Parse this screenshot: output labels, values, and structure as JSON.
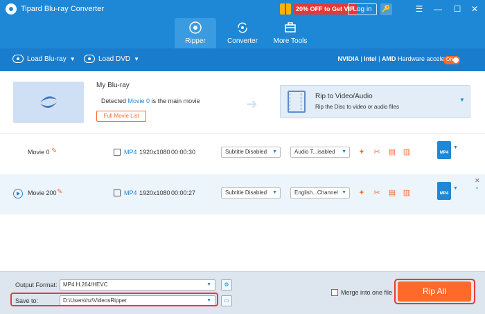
{
  "window": {
    "title": "Tipard Blu-ray Converter",
    "promo_text": "20% OFF to Get VIP",
    "login_label": "Log in",
    "controls": [
      "☰",
      "—",
      "☐",
      "✕"
    ]
  },
  "nav": {
    "tabs": [
      {
        "label": "Ripper",
        "icon": "ripper-icon",
        "active": true
      },
      {
        "label": "Converter",
        "icon": "converter-icon",
        "active": false
      },
      {
        "label": "More Tools",
        "icon": "toolbox-icon",
        "active": false
      }
    ]
  },
  "toolbar": {
    "load_bluray": "Load Blu-ray",
    "load_dvd": "Load DVD",
    "hw_nvidia": "NVIDIA",
    "hw_intel": "Intel",
    "hw_amd": "AMD",
    "hw_label": "Hardware acceleration",
    "hw_toggle": "ON"
  },
  "disc": {
    "name": "My Blu-ray",
    "detected_prefix": "Detected",
    "detected_movie": "Movie 0",
    "detected_suffix": "is the main movie",
    "full_list_label": "Full Movie List",
    "rip_title": "Rip to Video/Audio",
    "rip_sub": "Rip the Disc to video or audio files"
  },
  "movies": [
    {
      "name": "Movie 0",
      "format": "MP4",
      "resolution": "1920x1080",
      "duration": "00:00:30",
      "subtitle": "Subtitle Disabled",
      "audio": "Audio T...isabled",
      "output_format": "MP4"
    },
    {
      "name": "Movie 200",
      "format": "MP4",
      "resolution": "1920x1080",
      "duration": "00:00:27",
      "subtitle": "Subtitle Disabled",
      "audio": "English...Channel",
      "output_format": "MP4"
    }
  ],
  "bottom": {
    "output_format_label": "Output Format:",
    "output_format_value": "MP4 H.264/HEVC",
    "save_to_label": "Save to:",
    "save_to_value": "D:\\Users\\hz\\VideosRipper",
    "merge_label": "Merge into one file",
    "rip_all_label": "Rip All"
  },
  "colors": {
    "brand_blue": "#1e88d6",
    "accent_orange": "#ff6a2b",
    "highlight_red": "#e63a3a"
  }
}
